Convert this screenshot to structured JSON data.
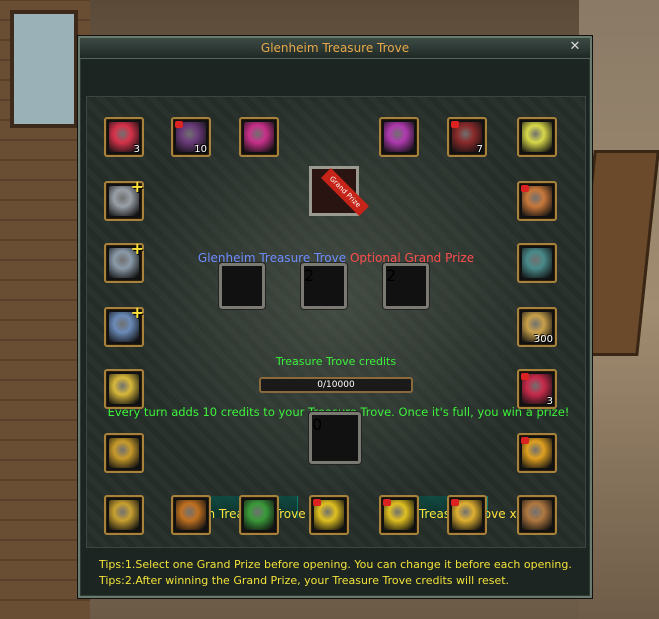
{
  "window": {
    "title": "Glenheim Treasure Trove"
  },
  "headline": {
    "name": "Glenheim Treasure Trove",
    "optional": "Optional Grand Prize"
  },
  "grand_prize": {
    "ribbon": "Grand Prize"
  },
  "top_row": [
    {
      "icon": "red-gem-ring-icon",
      "color": "#d8324a",
      "count": "3",
      "locked": false
    },
    {
      "icon": "wand-icon",
      "color": "#6a3a7a",
      "count": "10",
      "locked": true
    },
    {
      "icon": "pink-orb-icon",
      "color": "#c8308a",
      "count": "",
      "locked": false
    },
    {
      "icon": "purple-scroll-icon",
      "color": "#b03ab0",
      "count": "",
      "locked": false
    },
    {
      "icon": "crossbow-icon",
      "color": "#8a2a2a",
      "count": "7",
      "locked": true
    },
    {
      "icon": "yellow-crystal-icon",
      "color": "#d8d84a",
      "count": "",
      "locked": false
    }
  ],
  "left_col": [
    {
      "icon": "silver-blocks-icon",
      "color": "#9aa0a8",
      "plus": "+"
    },
    {
      "icon": "silver-triangle-icon",
      "color": "#8a9aa8",
      "plus": "+"
    },
    {
      "icon": "blue-crystal-rock-icon",
      "color": "#6a8ab8",
      "plus": "+"
    },
    {
      "icon": "gold-blocks-icon",
      "color": "#d8b83a",
      "plus": ""
    },
    {
      "icon": "gold-nugget-icon",
      "color": "#c89a2a",
      "plus": ""
    }
  ],
  "right_col": [
    {
      "icon": "lute-icon",
      "color": "#c8783a",
      "count": "",
      "locked": true
    },
    {
      "icon": "teal-chest-icon",
      "color": "#4a8a8a",
      "count": "",
      "locked": false
    },
    {
      "icon": "gold-star-badge-icon",
      "color": "#c8a04a",
      "count": "300",
      "locked": false
    },
    {
      "icon": "ruby-gem-icon",
      "color": "#c82a4a",
      "count": "3",
      "locked": true
    },
    {
      "icon": "gold-coin-icon",
      "color": "#e0a020",
      "count": "",
      "locked": true
    }
  ],
  "bottom_row": [
    {
      "icon": "gold-triangle-icon",
      "color": "#c8a030",
      "locked": false
    },
    {
      "icon": "golden-chest-icon",
      "color": "#c07020",
      "locked": false
    },
    {
      "icon": "green-emerald-icon",
      "color": "#3a9a3a",
      "locked": false
    },
    {
      "icon": "yellow-diamond-icon",
      "color": "#e0c020",
      "locked": true
    },
    {
      "icon": "yellow-diamond-icon",
      "color": "#e0c020",
      "locked": true
    },
    {
      "icon": "gold-disc-icon",
      "color": "#e0b030",
      "locked": true
    },
    {
      "icon": "winged-emblem-icon",
      "color": "#b07840",
      "locked": false
    }
  ],
  "prize_choices": [
    {
      "icon": "red-jewel-icon",
      "color": "#d0401a",
      "count": "",
      "locked": false
    },
    {
      "icon": "treasure-chest-icon",
      "color": "#b8501a",
      "count": "2",
      "locked": false
    },
    {
      "icon": "potion-icon",
      "color": "#c03a9a",
      "count": "2",
      "locked": true
    }
  ],
  "credits": {
    "label": "Treasure Trove credits",
    "text": "0/10000",
    "fraction": 0.0
  },
  "info": "Every turn adds 10 credits to your Treasure Trove. Once it's full, you win a prize!",
  "selected": {
    "icon": "wand-icon",
    "color": "#6a3a7a",
    "count": "0",
    "locked": true
  },
  "buttons": {
    "open_x1": "Open Treasure Trove x1",
    "open_x10": "Open Treasure Trove x10"
  },
  "tips": [
    "Tips:1.Select one Grand Prize before opening. You can change it before each opening.",
    "Tips:2.After winning the Grand Prize, your Treasure Trove credits will reset."
  ],
  "colors": {
    "accent": "#e8a94a",
    "green_text": "#3cf23c",
    "tips_text": "#f0e23a"
  }
}
